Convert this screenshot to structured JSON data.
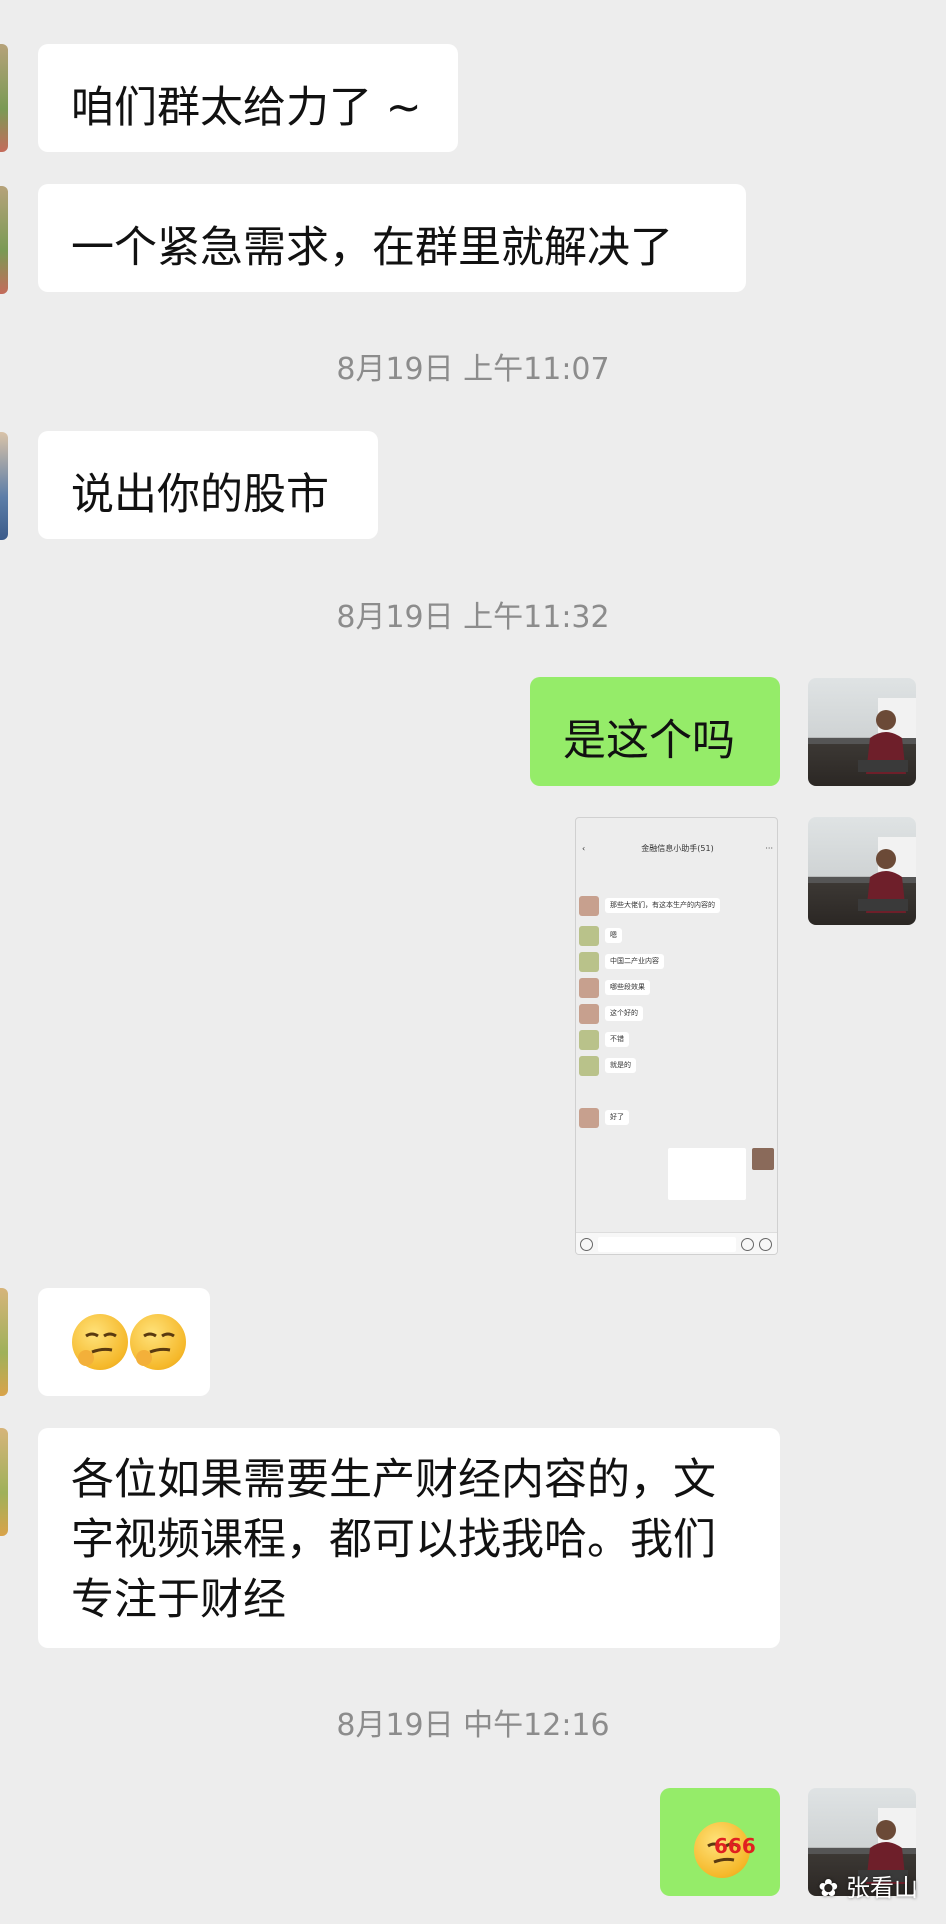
{
  "messages": {
    "m1": "咱们群太给力了 ~",
    "m2": "一个紧急需求，在群里就解决了",
    "m3": "说出你的股市",
    "m4": "是这个吗",
    "m6_line1": "各位如果需要生产财经内容的，文",
    "m6_line2": "字视频课程，都可以找我哈。我们",
    "m6_line3": "专注于财经"
  },
  "timestamps": {
    "t1": "8月19日 上午11:07",
    "t2": "8月19日 上午11:32",
    "t3": "8月19日 中午12:16"
  },
  "screenshot": {
    "title": "金融信息小助手(51)",
    "lines": [
      "那些大佬们，有这本生产的内容的",
      "嗯",
      "中国二产业内容",
      "哪些段效果",
      "这个好的",
      "不错",
      "就是的",
      "好了"
    ]
  },
  "sticker": {
    "label": "666"
  },
  "watermark": {
    "text": "张看山"
  },
  "colors": {
    "background": "#ededed",
    "bubble_in": "#ffffff",
    "bubble_out": "#95ec69",
    "timestamp": "#8c8c8c"
  }
}
